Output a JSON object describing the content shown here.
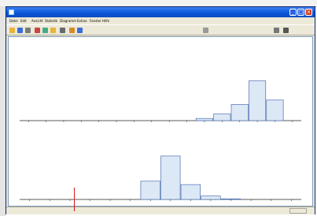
{
  "colors": {
    "title_bar": "#0a54d6",
    "bar_fill": "#dde8f6",
    "bar_stroke": "#4a6fb0",
    "axis": "#222222",
    "cursor": "#d01818"
  },
  "window": {
    "title": "",
    "controls": [
      "minimize-icon",
      "maximize-icon",
      "close-icon"
    ]
  },
  "menu": {
    "items": [
      "Datei",
      "Edit",
      "Ansicht",
      "Statistik",
      "Diagramm",
      "Extras",
      "Fenster",
      "Hilfe"
    ]
  },
  "toolbar": {
    "icons": [
      "open-icon",
      "save-icon",
      "print-icon",
      "cut-icon",
      "copy-icon",
      "paste-icon",
      "undo-icon",
      "chart-icon",
      "stats-icon",
      "zoom-icon",
      "filter-icon",
      "help-icon"
    ]
  },
  "document": {
    "header_left": "",
    "header_right": "",
    "subtitle": ""
  },
  "chart_data": [
    {
      "type": "bar",
      "categories": [
        "",
        "",
        "",
        "",
        "",
        "",
        "",
        "",
        "",
        "",
        "",
        "",
        "",
        "",
        "",
        ""
      ],
      "values": [
        0,
        0,
        0,
        0,
        0,
        0,
        0,
        0,
        0,
        0,
        1.5,
        4.5,
        11,
        27,
        14,
        0
      ],
      "label_texts": [
        "",
        "",
        "",
        "",
        "",
        "",
        "",
        "",
        "",
        "",
        "",
        "",
        "",
        "",
        "",
        ""
      ],
      "xlabel": "",
      "ylim": [
        0,
        30
      ]
    },
    {
      "type": "bar",
      "categories": [
        "",
        "",
        "",
        "",
        "",
        "",
        "",
        "",
        "",
        "",
        "",
        "",
        "",
        ""
      ],
      "values": [
        0,
        0,
        0,
        0,
        0,
        0,
        16,
        38,
        13,
        3,
        0.5,
        0,
        0,
        0
      ],
      "label_texts": [
        "",
        "",
        "",
        "",
        "",
        "",
        "",
        "",
        "",
        "",
        "",
        "",
        "",
        ""
      ],
      "xlabel": "",
      "ylim": [
        0,
        40
      ]
    }
  ],
  "status": {
    "left_text": "",
    "right_text": ""
  },
  "underlying_strip": {
    "values": []
  }
}
